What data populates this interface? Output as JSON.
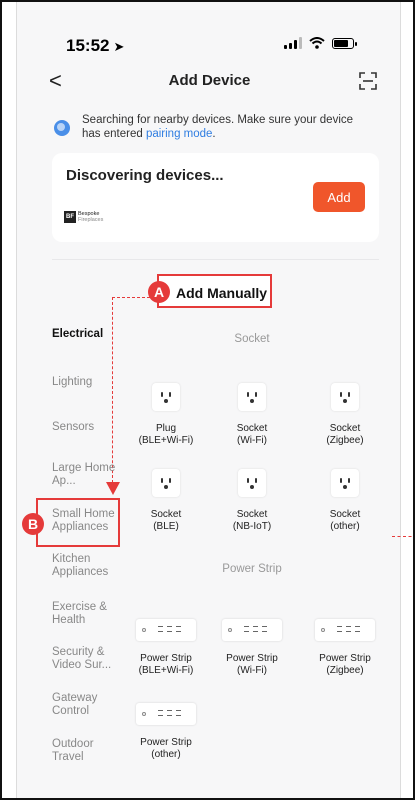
{
  "status_bar": {
    "time": "15:52",
    "location_glyph": "➤"
  },
  "header": {
    "title": "Add Device",
    "back_glyph": "<"
  },
  "notice": {
    "text": "Searching for nearby devices. Make sure your device has entered ",
    "link": "pairing mode",
    "suffix": "."
  },
  "discover_card": {
    "title": "Discovering devices...",
    "add_label": "Add",
    "brand_mark": "BF",
    "brand_line1": "Bespoke",
    "brand_line2": "Fireplaces"
  },
  "annotations": {
    "marker_a": "A",
    "marker_b": "B",
    "add_manually": "Add Manually"
  },
  "categories": [
    {
      "label": "Electrical",
      "active": true
    },
    {
      "label": "Lighting"
    },
    {
      "label": "Sensors"
    },
    {
      "label": "Large Home Ap..."
    },
    {
      "label": "Small Home Appliances"
    },
    {
      "label": "Kitchen Appliances"
    },
    {
      "label": "Exercise & Health"
    },
    {
      "label": "Security & Video Sur..."
    },
    {
      "label": "Gateway Control"
    },
    {
      "label": "Outdoor Travel"
    }
  ],
  "sections": {
    "socket": {
      "title": "Socket",
      "devices": [
        {
          "line1": "Plug",
          "line2": "(BLE+Wi-Fi)"
        },
        {
          "line1": "Socket",
          "line2": "(Wi-Fi)"
        },
        {
          "line1": "Socket",
          "line2": "(Zigbee)"
        },
        {
          "line1": "Socket",
          "line2": "(BLE)"
        },
        {
          "line1": "Socket",
          "line2": "(NB-IoT)"
        },
        {
          "line1": "Socket",
          "line2": "(other)"
        }
      ]
    },
    "power_strip": {
      "title": "Power Strip",
      "devices": [
        {
          "line1": "Power Strip",
          "line2": "(BLE+Wi-Fi)"
        },
        {
          "line1": "Power Strip",
          "line2": "(Wi-Fi)"
        },
        {
          "line1": "Power Strip",
          "line2": "(Zigbee)"
        },
        {
          "line1": "Power Strip",
          "line2": "(other)"
        }
      ]
    }
  },
  "colors": {
    "accent": "#f0562b",
    "annotation_red": "#e53a3a",
    "link_blue": "#2f7de1"
  }
}
